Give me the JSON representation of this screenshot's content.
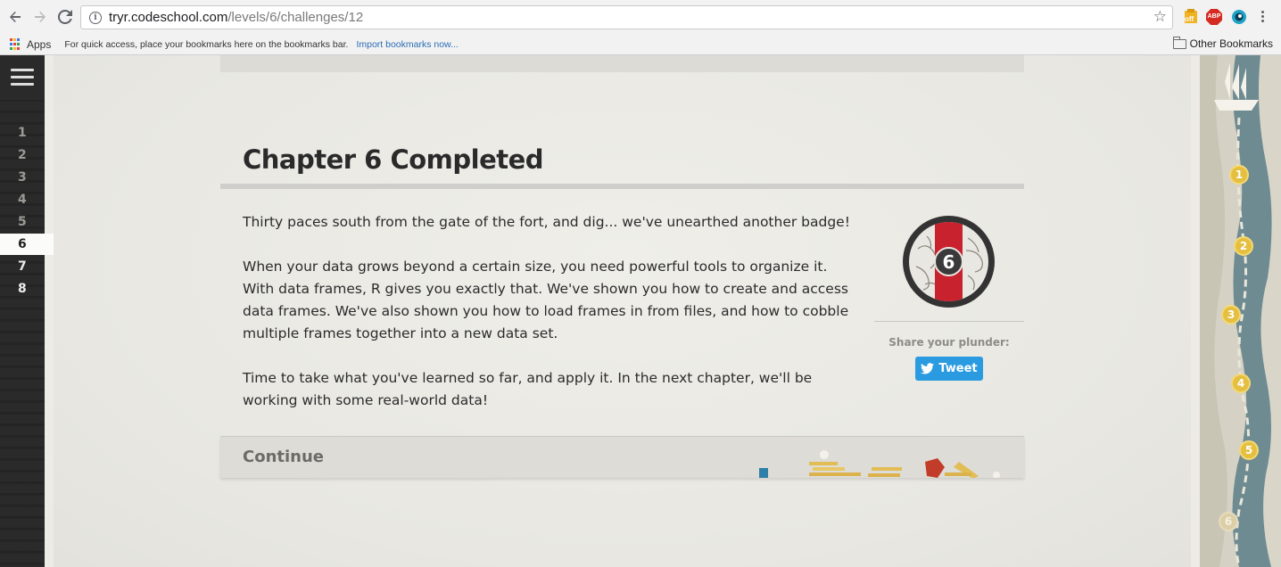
{
  "browser": {
    "url_host": "tryr.codeschool.com",
    "url_path": "/levels/6/challenges/12",
    "bookmarks": {
      "apps_label": "Apps",
      "quick_access_text": "For quick access, place your bookmarks here on the bookmarks bar.",
      "import_link": "Import bookmarks now...",
      "other_bookmarks": "Other Bookmarks"
    },
    "extensions": [
      {
        "name": "off-extension-icon",
        "label": "off"
      },
      {
        "name": "adblock-plus-icon",
        "label": "ABP"
      },
      {
        "name": "circle-extension-icon",
        "label": ""
      }
    ]
  },
  "sidebar": {
    "chapters": [
      "1",
      "2",
      "3",
      "4",
      "5",
      "6",
      "7",
      "8"
    ],
    "current": "6"
  },
  "content": {
    "title": "Chapter 6 Completed",
    "paragraphs": [
      "Thirty paces south from the gate of the fort, and dig... we've unearthed another badge!",
      "When your data grows beyond a certain size, you need powerful tools to organize it. With data frames, R gives you exactly that. We've shown you how to create and access data frames. We've also shown you how to load frames in from files, and how to cobble multiple frames together into a new data set.",
      "Time to take what you've learned so far, and apply it. In the next chapter, we'll be working with some real-world data!"
    ],
    "badge_number": "6",
    "share_label": "Share your plunder:",
    "tweet_label": "Tweet",
    "continue_label": "Continue"
  },
  "map": {
    "waypoints": [
      "1",
      "2",
      "3",
      "4",
      "5",
      "6"
    ]
  },
  "colors": {
    "tweet_blue": "#2b9be1",
    "badge_red": "#c8222f",
    "coin_gold": "#e5bf3f",
    "sidebar_dark": "#2a2a2a",
    "map_sea": "#6f8b92"
  }
}
